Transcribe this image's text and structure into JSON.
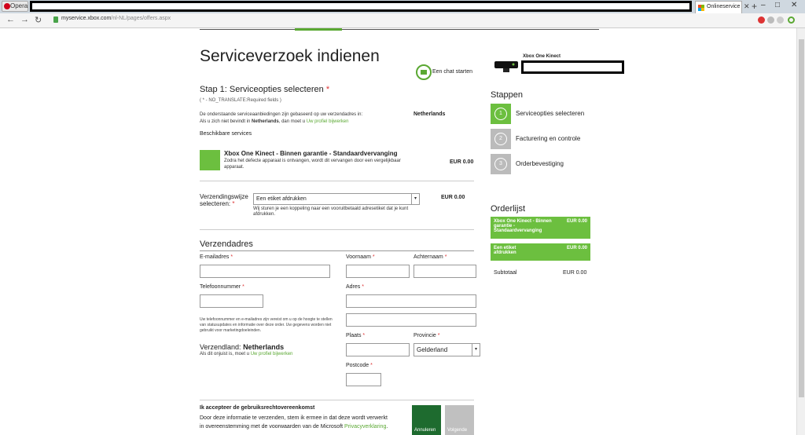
{
  "browser": {
    "app_button": "Opera",
    "tab_title": "Onlineservice",
    "url_host": "myservice.xbox.com",
    "url_path": "/nl-NL/pages/offers.aspx"
  },
  "page": {
    "title": "Serviceverzoek indienen",
    "chat_label": "Een chat starten",
    "step_heading": "Stap 1: Serviceopties selecteren",
    "required_note": "( * - NO_TRANSLATE:Required fields )",
    "intro_line1": "De onderstaande serviceaanbiedingen zijn gebaseerd op uw verzendadres in:",
    "intro_country": "Netherlands",
    "intro_line2_pre": "Als u zich niet bevindt in",
    "intro_line2_country": "Netherlands",
    "intro_line2_mid": ", dan moet u",
    "profile_link": "Uw profiel bijwerken",
    "services_heading": "Beschikbare services",
    "service": {
      "title": "Xbox One Kinect - Binnen garantie - Standaardvervanging",
      "desc": "Zodra het defecte apparaat is ontvangen, wordt dit vervangen door een vergelijkbaar apparaat.",
      "price": "EUR 0.00"
    },
    "shipping": {
      "label": "Verzendingswijze selecteren:",
      "selected": "Een etiket afdrukken",
      "desc": "Wij sturen je een koppeling naar een vooruitbetaald adresetiket dat je kunt afdrukken.",
      "price": "EUR 0.00"
    },
    "address": {
      "heading": "Verzendadres",
      "email": "E-mailadres",
      "firstname": "Voornaam",
      "lastname": "Achternaam",
      "phone": "Telefoonnummer",
      "street": "Adres",
      "privacy_note": "Uw telefoonnummer en e-mailadres zijn vereist om u op de hoogte te stellen van statusupdates en informatie over deze order. Uw gegevens worden niet gebruikt voor marketingdoeleinden.",
      "city": "Plaats",
      "province": "Provincie",
      "province_selected": "Gelderland",
      "postcode": "Postcode",
      "country_label": "Verzendland:",
      "country": "Netherlands",
      "country_note": "Als dit onjuist is, moet u",
      "country_link": "Uw profiel bijwerken"
    },
    "terms": {
      "heading": "Ik accepteer de gebruiksrechtovereenkomst",
      "text_line1": "Door deze informatie te verzenden, stem ik ermee in dat deze wordt verwerkt",
      "text_line2": "in overeenstemming met de voorwaarden van de Microsoft",
      "privacy_link": "Privacyverklaring",
      "cancel": "Annuleren",
      "next": "Volgende"
    }
  },
  "sidebar": {
    "product_name": "Xbox One Kinect",
    "steps_heading": "Stappen",
    "steps": [
      {
        "num": "1",
        "label": "Serviceopties selecteren"
      },
      {
        "num": "2",
        "label": "Facturering en controle"
      },
      {
        "num": "3",
        "label": "Orderbevestiging"
      }
    ],
    "order_heading": "Orderlijst",
    "order_items": [
      {
        "label": "Xbox One Kinect - Binnen garantie - Standaardvervanging",
        "price": "EUR 0.00"
      },
      {
        "label": "Een etiket afdrukken",
        "price": "EUR 0.00"
      }
    ],
    "subtotal_label": "Subtotaal",
    "subtotal_value": "EUR 0.00"
  },
  "colors": {
    "accent": "#6cbf3f",
    "dark_green": "#1e6b2f",
    "required": "#dd3333"
  }
}
